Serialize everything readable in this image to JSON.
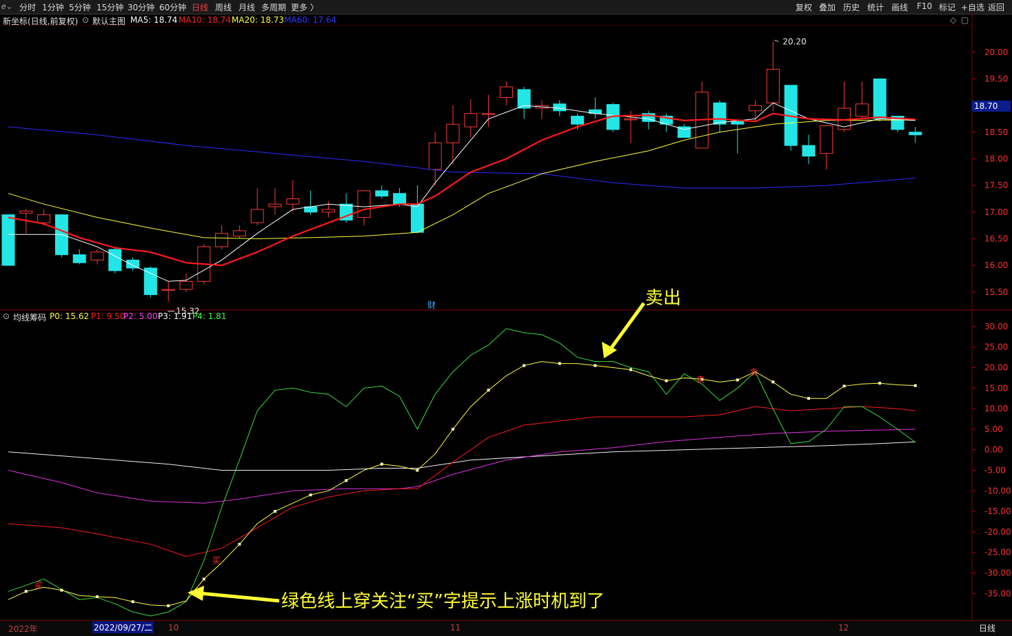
{
  "toolbar": {
    "logo": "𝑒⌄",
    "periods": [
      "分时",
      "1分钟",
      "5分钟",
      "15分钟",
      "30分钟",
      "60分钟",
      "日线",
      "周线",
      "月线",
      "多周期",
      "更多 〉"
    ],
    "active_period": "日线",
    "right_buttons": [
      "复权",
      "叠加",
      "历史",
      "统计",
      "画线",
      "F10",
      "标记",
      "+自选",
      "返回"
    ]
  },
  "main_header": {
    "title": "新坐标(日线,前复权)",
    "template": "默认主图",
    "ma5": "MA5: 18.74",
    "ma10": "MA10: 18.74",
    "ma20": "MA20: 18.73",
    "ma60": "MA60: 17.64",
    "colors": {
      "ma5": "#ffffff",
      "ma10": "#ff2020",
      "ma20": "#ffff40",
      "ma60": "#3030ff"
    }
  },
  "sub_header": {
    "title": "均线筹码",
    "p0": "P0: 15.62",
    "p1": "P1: 9.50",
    "p2": "P2: 5.00",
    "p3": "P3: 1.91",
    "p4": "P4: 1.81",
    "colors": {
      "p0": "#ffff40",
      "p1": "#ff2020",
      "p2": "#ff40ff",
      "p3": "#ffffff",
      "p4": "#40ff40"
    }
  },
  "price_axis": [
    "20.00",
    "19.50",
    "19.00",
    "18.50",
    "18.00",
    "17.50",
    "17.00",
    "16.50",
    "16.00",
    "15.50"
  ],
  "indicator_axis": [
    "30.00",
    "25.00",
    "20.00",
    "15.00",
    "10.00",
    "5.00",
    "0.00",
    "-5.00",
    "-10.00",
    "-15.00",
    "-20.00",
    "-25.00",
    "-30.00",
    "-35.00"
  ],
  "current_price": "18.70",
  "high_label": "20.20",
  "low_label": "15.32",
  "finance_marker": "财",
  "buy_marker": "买",
  "sell_marker": "卖",
  "annotations": {
    "sell": "卖出",
    "buy": "绿色线上穿关注“买”字提示上涨时机到了"
  },
  "date_axis": {
    "year_label": "2022年",
    "cursor_date": "2022/09/27/二",
    "months": [
      "10",
      "11",
      "12"
    ],
    "period": "日线"
  },
  "chart_data": {
    "type": "candlestick",
    "candles": [
      {
        "o": 16.95,
        "c": 16.0,
        "h": 16.95,
        "l": 16.0
      },
      {
        "o": 16.98,
        "c": 17.02,
        "h": 17.06,
        "l": 16.6
      },
      {
        "o": 16.8,
        "c": 16.95,
        "h": 17.05,
        "l": 16.75
      },
      {
        "o": 16.95,
        "c": 16.2,
        "h": 16.95,
        "l": 16.15
      },
      {
        "o": 16.2,
        "c": 16.05,
        "h": 16.3,
        "l": 16.02
      },
      {
        "o": 16.1,
        "c": 16.25,
        "h": 16.3,
        "l": 16.02
      },
      {
        "o": 16.3,
        "c": 15.9,
        "h": 16.35,
        "l": 15.85
      },
      {
        "o": 16.1,
        "c": 15.95,
        "h": 16.15,
        "l": 15.9
      },
      {
        "o": 15.95,
        "c": 15.45,
        "h": 15.98,
        "l": 15.4
      },
      {
        "o": 15.55,
        "c": 15.55,
        "h": 15.7,
        "l": 15.32
      },
      {
        "o": 15.55,
        "c": 15.7,
        "h": 15.85,
        "l": 15.5
      },
      {
        "o": 15.7,
        "c": 16.35,
        "h": 16.4,
        "l": 15.65
      },
      {
        "o": 16.35,
        "c": 16.6,
        "h": 16.75,
        "l": 16.3
      },
      {
        "o": 16.55,
        "c": 16.65,
        "h": 16.75,
        "l": 16.5
      },
      {
        "o": 16.8,
        "c": 17.05,
        "h": 17.45,
        "l": 16.75
      },
      {
        "o": 17.1,
        "c": 17.15,
        "h": 17.45,
        "l": 16.95
      },
      {
        "o": 17.15,
        "c": 17.25,
        "h": 17.6,
        "l": 17.0
      },
      {
        "o": 17.1,
        "c": 17.0,
        "h": 17.4,
        "l": 16.95
      },
      {
        "o": 17.0,
        "c": 17.05,
        "h": 17.2,
        "l": 16.9
      },
      {
        "o": 17.15,
        "c": 16.85,
        "h": 17.35,
        "l": 16.8
      },
      {
        "o": 16.9,
        "c": 17.4,
        "h": 17.4,
        "l": 16.75
      },
      {
        "o": 17.4,
        "c": 17.3,
        "h": 17.5,
        "l": 17.25
      },
      {
        "o": 17.35,
        "c": 17.15,
        "h": 17.45,
        "l": 17.1
      },
      {
        "o": 17.15,
        "c": 16.62,
        "h": 17.5,
        "l": 16.6
      },
      {
        "o": 17.8,
        "c": 18.3,
        "h": 18.5,
        "l": 17.5
      },
      {
        "o": 18.3,
        "c": 18.65,
        "h": 19.0,
        "l": 17.9
      },
      {
        "o": 18.6,
        "c": 18.85,
        "h": 19.12,
        "l": 18.4
      },
      {
        "o": 18.85,
        "c": 18.85,
        "h": 19.2,
        "l": 18.6
      },
      {
        "o": 19.15,
        "c": 19.35,
        "h": 19.45,
        "l": 19.0
      },
      {
        "o": 19.3,
        "c": 18.95,
        "h": 19.35,
        "l": 18.75
      },
      {
        "o": 18.95,
        "c": 19.0,
        "h": 19.1,
        "l": 18.75
      },
      {
        "o": 19.03,
        "c": 18.9,
        "h": 19.1,
        "l": 18.8
      },
      {
        "o": 18.8,
        "c": 18.65,
        "h": 18.85,
        "l": 18.55
      },
      {
        "o": 18.92,
        "c": 18.85,
        "h": 19.15,
        "l": 18.75
      },
      {
        "o": 19.02,
        "c": 18.55,
        "h": 19.05,
        "l": 18.5
      },
      {
        "o": 18.75,
        "c": 18.75,
        "h": 18.9,
        "l": 18.3
      },
      {
        "o": 18.85,
        "c": 18.7,
        "h": 18.9,
        "l": 18.55
      },
      {
        "o": 18.8,
        "c": 18.65,
        "h": 18.85,
        "l": 18.5
      },
      {
        "o": 18.6,
        "c": 18.4,
        "h": 18.65,
        "l": 18.4
      },
      {
        "o": 18.2,
        "c": 19.25,
        "h": 19.45,
        "l": 18.2
      },
      {
        "o": 19.05,
        "c": 18.65,
        "h": 19.1,
        "l": 18.5
      },
      {
        "o": 18.7,
        "c": 18.65,
        "h": 18.7,
        "l": 18.1
      },
      {
        "o": 18.9,
        "c": 19.0,
        "h": 19.1,
        "l": 18.7
      },
      {
        "o": 19.05,
        "c": 19.68,
        "h": 20.2,
        "l": 18.9
      },
      {
        "o": 19.38,
        "c": 18.25,
        "h": 19.38,
        "l": 18.15
      },
      {
        "o": 18.25,
        "c": 18.05,
        "h": 18.45,
        "l": 17.9
      },
      {
        "o": 18.1,
        "c": 18.62,
        "h": 18.62,
        "l": 17.8
      },
      {
        "o": 18.55,
        "c": 18.95,
        "h": 19.45,
        "l": 18.5
      },
      {
        "o": 18.8,
        "c": 19.03,
        "h": 19.45,
        "l": 18.75
      },
      {
        "o": 19.5,
        "c": 18.75,
        "h": 19.5,
        "l": 18.7
      },
      {
        "o": 18.8,
        "c": 18.55,
        "h": 18.8,
        "l": 18.5
      },
      {
        "o": 18.5,
        "c": 18.45,
        "h": 18.6,
        "l": 18.3
      }
    ],
    "ma5": [
      [
        0,
        16.58
      ],
      [
        1,
        16.58
      ],
      [
        3,
        16.58
      ],
      [
        5,
        16.35
      ],
      [
        7,
        16.0
      ],
      [
        9,
        15.7
      ],
      [
        10,
        15.72
      ],
      [
        12,
        16.1
      ],
      [
        14,
        16.6
      ],
      [
        16,
        17.05
      ],
      [
        18,
        17.15
      ],
      [
        20,
        17.1
      ],
      [
        22,
        17.15
      ],
      [
        23,
        17.1
      ],
      [
        24,
        17.55
      ],
      [
        25,
        17.95
      ],
      [
        26,
        18.35
      ],
      [
        27,
        18.75
      ],
      [
        29,
        19.0
      ],
      [
        31,
        18.95
      ],
      [
        33,
        18.85
      ],
      [
        36,
        18.75
      ],
      [
        38,
        18.55
      ],
      [
        40,
        18.68
      ],
      [
        42,
        18.75
      ],
      [
        43,
        19.05
      ],
      [
        45,
        18.75
      ],
      [
        47,
        18.6
      ],
      [
        49,
        18.75
      ],
      [
        51,
        18.72
      ]
    ],
    "ma10": [
      [
        0,
        16.9
      ],
      [
        2,
        16.78
      ],
      [
        4,
        16.52
      ],
      [
        6,
        16.33
      ],
      [
        8,
        16.25
      ],
      [
        10,
        16.05
      ],
      [
        12,
        16.0
      ],
      [
        14,
        16.25
      ],
      [
        16,
        16.55
      ],
      [
        18,
        16.8
      ],
      [
        20,
        17.05
      ],
      [
        22,
        17.15
      ],
      [
        23,
        17.15
      ],
      [
        24,
        17.3
      ],
      [
        26,
        17.75
      ],
      [
        28,
        18.0
      ],
      [
        30,
        18.35
      ],
      [
        32,
        18.6
      ],
      [
        34,
        18.8
      ],
      [
        36,
        18.82
      ],
      [
        38,
        18.72
      ],
      [
        40,
        18.75
      ],
      [
        42,
        18.7
      ],
      [
        43,
        18.85
      ],
      [
        45,
        18.75
      ],
      [
        47,
        18.73
      ],
      [
        49,
        18.78
      ],
      [
        51,
        18.74
      ]
    ],
    "ma20": [
      [
        0,
        17.35
      ],
      [
        2,
        17.15
      ],
      [
        5,
        16.9
      ],
      [
        8,
        16.7
      ],
      [
        11,
        16.52
      ],
      [
        14,
        16.5
      ],
      [
        17,
        16.52
      ],
      [
        20,
        16.55
      ],
      [
        23,
        16.62
      ],
      [
        25,
        16.95
      ],
      [
        27,
        17.35
      ],
      [
        30,
        17.72
      ],
      [
        33,
        17.95
      ],
      [
        36,
        18.15
      ],
      [
        38,
        18.35
      ],
      [
        40,
        18.5
      ],
      [
        43,
        18.65
      ],
      [
        46,
        18.72
      ],
      [
        51,
        18.73
      ]
    ],
    "ma60": [
      [
        0,
        18.6
      ],
      [
        5,
        18.45
      ],
      [
        10,
        18.25
      ],
      [
        15,
        18.1
      ],
      [
        20,
        17.95
      ],
      [
        25,
        17.75
      ],
      [
        30,
        17.72
      ],
      [
        34,
        17.55
      ],
      [
        38,
        17.45
      ],
      [
        42,
        17.45
      ],
      [
        46,
        17.5
      ],
      [
        49,
        17.58
      ],
      [
        51,
        17.64
      ]
    ],
    "p0": [
      [
        0,
        -36.5
      ],
      [
        1,
        -34.5
      ],
      [
        2,
        -33.5
      ],
      [
        3,
        -34.2
      ],
      [
        4,
        -35.5
      ],
      [
        5,
        -35.8
      ],
      [
        6,
        -36.0
      ],
      [
        7,
        -37.0
      ],
      [
        8,
        -37.8
      ],
      [
        9,
        -38.0
      ],
      [
        10,
        -36.8
      ],
      [
        11,
        -31.5
      ],
      [
        12,
        -27.5
      ],
      [
        13,
        -23.0
      ],
      [
        14,
        -18.0
      ],
      [
        15,
        -15.0
      ],
      [
        16,
        -13.0
      ],
      [
        17,
        -11.0
      ],
      [
        18,
        -10.0
      ],
      [
        19,
        -7.5
      ],
      [
        20,
        -5.0
      ],
      [
        21,
        -3.5
      ],
      [
        22,
        -4.0
      ],
      [
        23,
        -5.0
      ],
      [
        24,
        -1.0
      ],
      [
        25,
        5.0
      ],
      [
        26,
        10.5
      ],
      [
        27,
        14.5
      ],
      [
        28,
        18.0
      ],
      [
        29,
        20.5
      ],
      [
        30,
        21.5
      ],
      [
        31,
        21.0
      ],
      [
        32,
        21.0
      ],
      [
        33,
        20.5
      ],
      [
        34,
        20.0
      ],
      [
        35,
        19.5
      ],
      [
        36,
        18.0
      ],
      [
        37,
        16.8
      ],
      [
        38,
        17.5
      ],
      [
        39,
        17.2
      ],
      [
        40,
        16.5
      ],
      [
        41,
        17.0
      ],
      [
        42,
        19.0
      ],
      [
        43,
        16.5
      ],
      [
        44,
        13.5
      ],
      [
        45,
        12.5
      ],
      [
        46,
        12.5
      ],
      [
        47,
        15.5
      ],
      [
        48,
        16.0
      ],
      [
        49,
        16.2
      ],
      [
        50,
        15.8
      ],
      [
        51,
        15.62
      ]
    ],
    "p1": [
      [
        0,
        -18.0
      ],
      [
        3,
        -19.0
      ],
      [
        5,
        -20.5
      ],
      [
        8,
        -23.0
      ],
      [
        10,
        -26.0
      ],
      [
        12,
        -24.0
      ],
      [
        14,
        -19.0
      ],
      [
        16,
        -14.0
      ],
      [
        18,
        -11.5
      ],
      [
        20,
        -10.0
      ],
      [
        22,
        -9.5
      ],
      [
        23,
        -9.5
      ],
      [
        25,
        -3.0
      ],
      [
        27,
        3.0
      ],
      [
        29,
        6.0
      ],
      [
        31,
        7.0
      ],
      [
        33,
        8.0
      ],
      [
        36,
        8.0
      ],
      [
        38,
        8.0
      ],
      [
        40,
        8.5
      ],
      [
        42,
        10.5
      ],
      [
        44,
        9.5
      ],
      [
        46,
        10.0
      ],
      [
        48,
        10.5
      ],
      [
        50,
        10.0
      ],
      [
        51,
        9.5
      ]
    ],
    "p2": [
      [
        0,
        -5.0
      ],
      [
        3,
        -8.0
      ],
      [
        5,
        -10.5
      ],
      [
        8,
        -12.5
      ],
      [
        11,
        -13.0
      ],
      [
        13,
        -12.0
      ],
      [
        16,
        -10.0
      ],
      [
        19,
        -9.5
      ],
      [
        22,
        -9.5
      ],
      [
        23,
        -9.0
      ],
      [
        25,
        -6.0
      ],
      [
        28,
        -2.5
      ],
      [
        31,
        -0.5
      ],
      [
        34,
        0.5
      ],
      [
        37,
        2.0
      ],
      [
        40,
        3.0
      ],
      [
        43,
        4.0
      ],
      [
        46,
        4.5
      ],
      [
        49,
        4.8
      ],
      [
        51,
        5.0
      ]
    ],
    "p3": [
      [
        0,
        -0.5
      ],
      [
        3,
        -1.5
      ],
      [
        6,
        -2.5
      ],
      [
        9,
        -3.5
      ],
      [
        12,
        -5.0
      ],
      [
        15,
        -5.0
      ],
      [
        18,
        -5.0
      ],
      [
        21,
        -4.5
      ],
      [
        23,
        -4.5
      ],
      [
        26,
        -2.5
      ],
      [
        30,
        -1.5
      ],
      [
        34,
        -0.5
      ],
      [
        38,
        0.0
      ],
      [
        42,
        0.5
      ],
      [
        46,
        1.0
      ],
      [
        49,
        1.5
      ],
      [
        51,
        1.91
      ]
    ],
    "p4": [
      [
        0,
        -34.5
      ],
      [
        1,
        -33.0
      ],
      [
        2,
        -31.5
      ],
      [
        3,
        -34.0
      ],
      [
        4,
        -36.5
      ],
      [
        5,
        -36.0
      ],
      [
        6,
        -37.5
      ],
      [
        7,
        -39.5
      ],
      [
        8,
        -40.5
      ],
      [
        9,
        -39.5
      ],
      [
        10,
        -37.0
      ],
      [
        11,
        -27.0
      ],
      [
        12,
        -14.0
      ],
      [
        13,
        -2.5
      ],
      [
        14,
        9.5
      ],
      [
        15,
        14.5
      ],
      [
        16,
        15.0
      ],
      [
        17,
        14.0
      ],
      [
        18,
        13.5
      ],
      [
        19,
        10.5
      ],
      [
        20,
        15.0
      ],
      [
        21,
        15.5
      ],
      [
        22,
        13.0
      ],
      [
        23,
        5.0
      ],
      [
        24,
        13.5
      ],
      [
        25,
        19.0
      ],
      [
        26,
        23.0
      ],
      [
        27,
        25.5
      ],
      [
        28,
        29.5
      ],
      [
        29,
        28.5
      ],
      [
        30,
        28.0
      ],
      [
        31,
        26.0
      ],
      [
        32,
        22.5
      ],
      [
        33,
        21.5
      ],
      [
        34,
        21.5
      ],
      [
        35,
        20.0
      ],
      [
        36,
        19.0
      ],
      [
        37,
        13.5
      ],
      [
        38,
        18.5
      ],
      [
        39,
        16.0
      ],
      [
        40,
        12.0
      ],
      [
        41,
        15.0
      ],
      [
        42,
        19.0
      ],
      [
        43,
        10.0
      ],
      [
        44,
        1.5
      ],
      [
        45,
        2.0
      ],
      [
        46,
        5.0
      ],
      [
        47,
        10.5
      ],
      [
        48,
        10.5
      ],
      [
        49,
        8.0
      ],
      [
        50,
        5.0
      ],
      [
        51,
        1.81
      ]
    ],
    "buy_indices": [
      1,
      11
    ],
    "sell_indices": [
      39,
      42
    ],
    "price_range": [
      15.2,
      20.45
    ],
    "indicator_range": [
      -41.5,
      32.0
    ]
  }
}
